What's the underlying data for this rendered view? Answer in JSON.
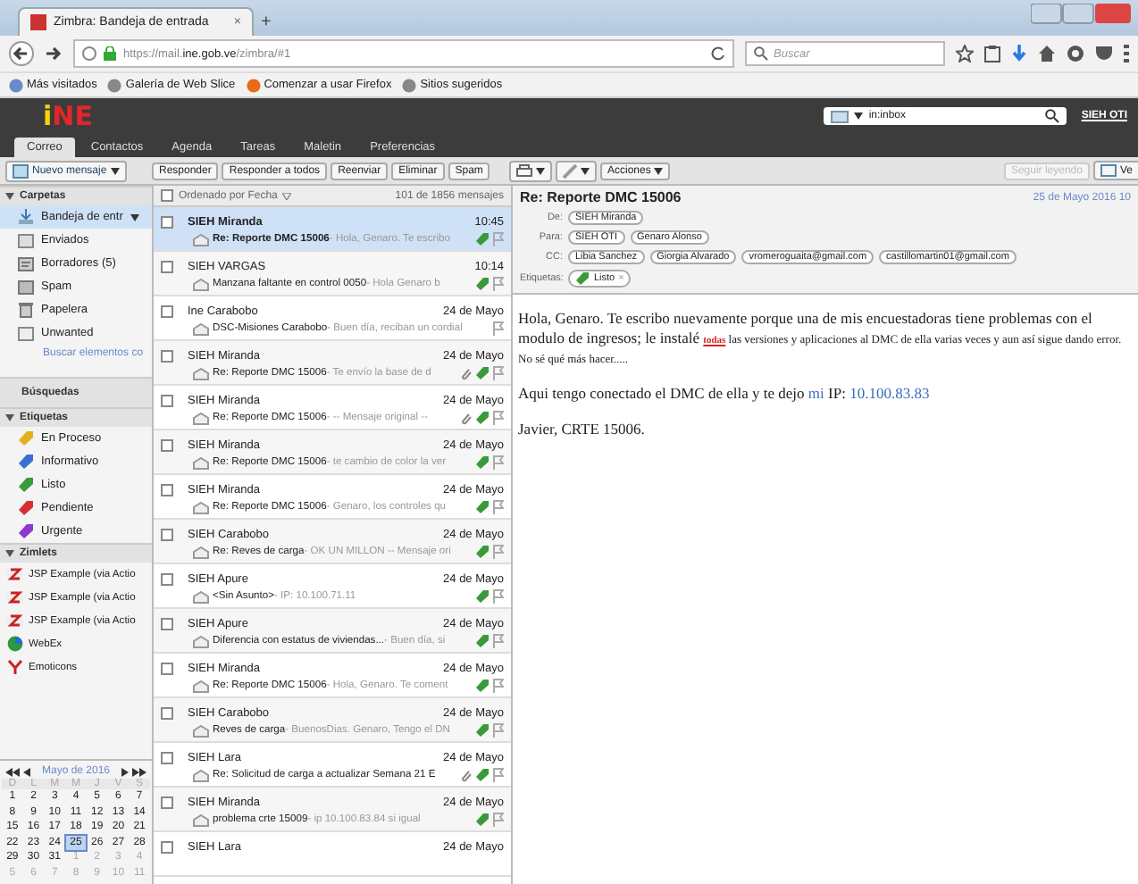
{
  "browser": {
    "tab_title": "Zimbra: Bandeja de entrada",
    "tab_close": "×",
    "new_tab": "+",
    "url_prefix": "https://mail.",
    "url_host": "ine.gob.ve",
    "url_path": "/zimbra/#1",
    "search_placeholder": "Buscar"
  },
  "bookmarks": [
    "Más visitados",
    "Galería de Web Slice",
    "Comenzar a usar Firefox",
    "Sitios sugeridos"
  ],
  "app": {
    "logo": [
      {
        "text": "i",
        "color": "#f5d20a"
      },
      {
        "text": "NE",
        "color": "#e2262a"
      }
    ],
    "search_value": "in:inbox",
    "user": "SIEH OTI"
  },
  "app_tabs": [
    {
      "label": "Correo",
      "selected": true
    },
    {
      "label": "Contactos",
      "selected": false
    },
    {
      "label": "Agenda",
      "selected": false
    },
    {
      "label": "Tareas",
      "selected": false
    },
    {
      "label": "Maletin",
      "selected": false
    },
    {
      "label": "Preferencias",
      "selected": false
    }
  ],
  "toolbar": {
    "new_message": "Nuevo mensaje",
    "actions": [
      "Responder",
      "Responder a todos",
      "Reenviar",
      "Eliminar",
      "Spam"
    ],
    "more": "Acciones",
    "continue": {
      "label": "Seguir leyendo",
      "disabled": true
    },
    "view": "Ve"
  },
  "sidebar": {
    "folders_title": "Carpetas",
    "folders": [
      {
        "label": "Bandeja de entr",
        "kind": "inbox",
        "selected": true
      },
      {
        "label": "Enviados",
        "kind": "sent",
        "selected": false
      },
      {
        "label": "Borradores (5)",
        "kind": "drafts",
        "selected": false
      },
      {
        "label": "Spam",
        "kind": "spam",
        "selected": false
      },
      {
        "label": "Papelera",
        "kind": "trash",
        "selected": false
      },
      {
        "label": "Unwanted",
        "kind": "folder",
        "selected": false
      }
    ],
    "search_link": "Buscar elementos co",
    "searches_title": "Búsquedas",
    "tags_title": "Etiquetas",
    "tags": [
      {
        "label": "En Proceso",
        "color": "#e0b020"
      },
      {
        "label": "Informativo",
        "color": "#3a6fd0"
      },
      {
        "label": "Listo",
        "color": "#3a9a3a"
      },
      {
        "label": "Pendiente",
        "color": "#d83030"
      },
      {
        "label": "Urgente",
        "color": "#8a3ad0"
      }
    ],
    "zimlets_title": "Zimlets",
    "zimlets": [
      {
        "label": "JSP Example (via Actio",
        "kind": "zimbra"
      },
      {
        "label": "JSP Example (via Actio",
        "kind": "zimbra"
      },
      {
        "label": "JSP Example (via Actio",
        "kind": "zimbra"
      },
      {
        "label": "WebEx",
        "kind": "globe"
      },
      {
        "label": "Emoticons",
        "kind": "emoticon"
      }
    ]
  },
  "calendar": {
    "title": "Mayo de 2016",
    "weekdays": [
      "D",
      "L",
      "M",
      "M",
      "J",
      "V",
      "S"
    ],
    "weeks": [
      [
        {
          "d": "1",
          "other": false,
          "selected": false
        },
        {
          "d": "2",
          "other": false,
          "selected": false
        },
        {
          "d": "3",
          "other": false,
          "selected": false
        },
        {
          "d": "4",
          "other": false,
          "selected": false
        },
        {
          "d": "5",
          "other": false,
          "selected": false
        },
        {
          "d": "6",
          "other": false,
          "selected": false
        },
        {
          "d": "7",
          "other": false,
          "selected": false
        }
      ],
      [
        {
          "d": "8",
          "other": false,
          "selected": false
        },
        {
          "d": "9",
          "other": false,
          "selected": false
        },
        {
          "d": "10",
          "other": false,
          "selected": false
        },
        {
          "d": "11",
          "other": false,
          "selected": false
        },
        {
          "d": "12",
          "other": false,
          "selected": false
        },
        {
          "d": "13",
          "other": false,
          "selected": false
        },
        {
          "d": "14",
          "other": false,
          "selected": false
        }
      ],
      [
        {
          "d": "15",
          "other": false,
          "selected": false
        },
        {
          "d": "16",
          "other": false,
          "selected": false
        },
        {
          "d": "17",
          "other": false,
          "selected": false
        },
        {
          "d": "18",
          "other": false,
          "selected": false
        },
        {
          "d": "19",
          "other": false,
          "selected": false
        },
        {
          "d": "20",
          "other": false,
          "selected": false
        },
        {
          "d": "21",
          "other": false,
          "selected": false
        }
      ],
      [
        {
          "d": "22",
          "other": false,
          "selected": false
        },
        {
          "d": "23",
          "other": false,
          "selected": false
        },
        {
          "d": "24",
          "other": false,
          "selected": false
        },
        {
          "d": "25",
          "other": false,
          "selected": true
        },
        {
          "d": "26",
          "other": false,
          "selected": false
        },
        {
          "d": "27",
          "other": false,
          "selected": false
        },
        {
          "d": "28",
          "other": false,
          "selected": false
        }
      ],
      [
        {
          "d": "29",
          "other": false,
          "selected": false
        },
        {
          "d": "30",
          "other": false,
          "selected": false
        },
        {
          "d": "31",
          "other": false,
          "selected": false
        },
        {
          "d": "1",
          "other": true,
          "selected": false
        },
        {
          "d": "2",
          "other": true,
          "selected": false
        },
        {
          "d": "3",
          "other": true,
          "selected": false
        },
        {
          "d": "4",
          "other": true,
          "selected": false
        }
      ],
      [
        {
          "d": "5",
          "other": true,
          "selected": false
        },
        {
          "d": "6",
          "other": true,
          "selected": false
        },
        {
          "d": "7",
          "other": true,
          "selected": false
        },
        {
          "d": "8",
          "other": true,
          "selected": false
        },
        {
          "d": "9",
          "other": true,
          "selected": false
        },
        {
          "d": "10",
          "other": true,
          "selected": false
        },
        {
          "d": "11",
          "other": true,
          "selected": false
        }
      ]
    ]
  },
  "list": {
    "select_all_checked": false,
    "sort": "Ordenado por Fecha",
    "count": "101 de 1856 mensajes",
    "messages": [
      {
        "sender": "SIEH Miranda",
        "time": "10:45",
        "subject": "Re: Reporte DMC 15006",
        "preview": "- Hola, Genaro. Te escribo",
        "attachment": false,
        "tagged": true,
        "selected": true
      },
      {
        "sender": "SIEH VARGAS",
        "time": "10:14",
        "subject": "Manzana faltante en control 0050",
        "preview": "- Hola Genaro b",
        "attachment": false,
        "tagged": true,
        "selected": false
      },
      {
        "sender": "Ine Carabobo",
        "time": "24 de Mayo",
        "subject": "DSC-Misiones Carabobo",
        "preview": "- Buen día, reciban un cordial",
        "attachment": false,
        "tagged": false,
        "selected": false
      },
      {
        "sender": "SIEH Miranda",
        "time": "24 de Mayo",
        "subject": "Re: Reporte DMC 15006",
        "preview": "- Te envío la base de d",
        "attachment": true,
        "tagged": true,
        "selected": false
      },
      {
        "sender": "SIEH Miranda",
        "time": "24 de Mayo",
        "subject": "Re: Reporte DMC 15006",
        "preview": "- -- Mensaje original --",
        "attachment": true,
        "tagged": true,
        "selected": false
      },
      {
        "sender": "SIEH Miranda",
        "time": "24 de Mayo",
        "subject": "Re: Reporte DMC 15006",
        "preview": "- te cambio de color la ver",
        "attachment": false,
        "tagged": true,
        "selected": false
      },
      {
        "sender": "SIEH Miranda",
        "time": "24 de Mayo",
        "subject": "Re: Reporte DMC 15006",
        "preview": "- Genaro, los controles qu",
        "attachment": false,
        "tagged": true,
        "selected": false
      },
      {
        "sender": "SIEH Carabobo",
        "time": "24 de Mayo",
        "subject": "Re: Reves de carga",
        "preview": "- OK UN MILLON -- Mensaje ori",
        "attachment": false,
        "tagged": true,
        "selected": false
      },
      {
        "sender": "SIEH Apure",
        "time": "24 de Mayo",
        "subject": "<Sin Asunto>",
        "preview": "- IP: 10.100.71.11",
        "attachment": false,
        "tagged": true,
        "selected": false
      },
      {
        "sender": "SIEH Apure",
        "time": "24 de Mayo",
        "subject": "Diferencia con estatus de viviendas...",
        "preview": "- Buen día, si",
        "attachment": false,
        "tagged": true,
        "selected": false
      },
      {
        "sender": "SIEH Miranda",
        "time": "24 de Mayo",
        "subject": "Re: Reporte DMC 15006",
        "preview": "- Hola, Genaro. Te coment",
        "attachment": false,
        "tagged": true,
        "selected": false
      },
      {
        "sender": "SIEH Carabobo",
        "time": "24 de Mayo",
        "subject": "Reves de carga",
        "preview": "- BuenosDias. Genaro, Tengo el DN",
        "attachment": false,
        "tagged": true,
        "selected": false
      },
      {
        "sender": "SIEH Lara",
        "time": "24 de Mayo",
        "subject": "Re: Solicitud de carga a actualizar Semana 21 E",
        "attachment": true,
        "tagged": true,
        "selected": false
      },
      {
        "sender": "SIEH Miranda",
        "time": "24 de Mayo",
        "subject": "problema crte 15009",
        "preview": "- ip 10.100.83.84 si igual",
        "attachment": false,
        "tagged": true,
        "selected": false
      },
      {
        "sender": "SIEH Lara",
        "time": "24 de Mayo",
        "attachment": false,
        "tagged": false,
        "selected": false
      }
    ]
  },
  "reader": {
    "subject": "Re: Reporte DMC 15006",
    "date": "25 de Mayo 2016 10",
    "headers": [
      {
        "label": "De:",
        "values": [
          "SIEH Miranda"
        ]
      },
      {
        "label": "Para:",
        "values": [
          "SIEH OTI",
          "Genaro Alonso"
        ]
      },
      {
        "label": "CC:",
        "values": [
          "Libia Sanchez",
          "Giorgia Alvarado",
          "vromeroguaita@gmail.com",
          "castillomartin01@gmail.com"
        ]
      }
    ],
    "tags_label": "Etiquetas:",
    "tag": "Listo",
    "tag_remove": "×",
    "body": [
      [
        {
          "kind": "plain",
          "text": "Hola, Genaro. Te escribo nuevamente porque una de mis encuestadoras tiene problemas con el modulo de ingresos; le instalé "
        },
        {
          "kind": "highlight",
          "text": "todas"
        },
        {
          "kind": "small",
          "text": " las versiones y aplicaciones al DMC de ella varias veces y aun así sigue dando error. No sé qué más hacer....."
        }
      ],
      [
        {
          "kind": "plain",
          "text": "Aqui tengo conectado el DMC de ella y te dejo "
        },
        {
          "kind": "link",
          "text": "mi"
        },
        {
          "kind": "plain",
          "text": " IP: "
        },
        {
          "kind": "link",
          "text": "10.100.83.83"
        }
      ],
      [
        {
          "kind": "plain",
          "text": "Javier, CRTE 15006."
        }
      ]
    ]
  }
}
